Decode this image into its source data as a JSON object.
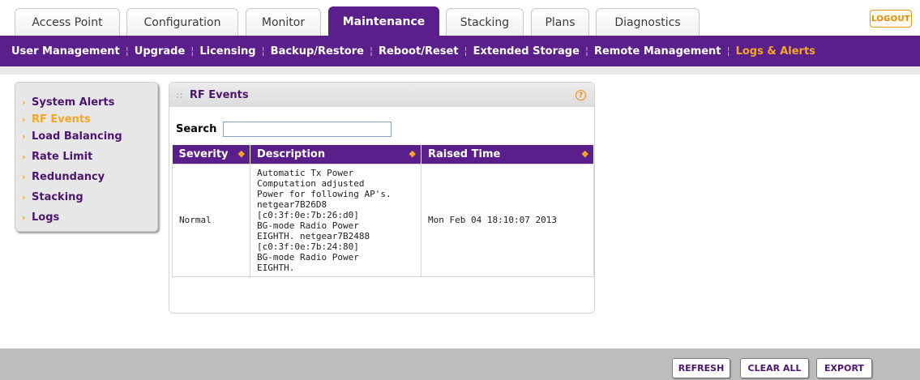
{
  "tabs": [
    {
      "label": "Access Point",
      "active": false
    },
    {
      "label": "Configuration",
      "active": false
    },
    {
      "label": "Monitor",
      "active": false
    },
    {
      "label": "Maintenance",
      "active": true
    },
    {
      "label": "Stacking",
      "active": false
    },
    {
      "label": "Plans",
      "active": false
    },
    {
      "label": "Diagnostics",
      "active": false
    }
  ],
  "logout_label": "LOGOUT",
  "subnav": [
    {
      "label": "User Management",
      "active": false
    },
    {
      "label": "Upgrade",
      "active": false
    },
    {
      "label": "Licensing",
      "active": false
    },
    {
      "label": "Backup/Restore",
      "active": false
    },
    {
      "label": "Reboot/Reset",
      "active": false
    },
    {
      "label": "Extended Storage",
      "active": false
    },
    {
      "label": "Remote Management",
      "active": false
    },
    {
      "label": "Logs & Alerts",
      "active": true
    }
  ],
  "leftmenu": [
    {
      "label": "System Alerts",
      "active": false
    },
    {
      "label": "RF Events",
      "active": true
    },
    {
      "label": "Load Balancing",
      "active": false
    },
    {
      "label": "Rate Limit",
      "active": false
    },
    {
      "label": "Redundancy",
      "active": false
    },
    {
      "label": "Stacking",
      "active": false
    },
    {
      "label": "Logs",
      "active": false
    }
  ],
  "panel": {
    "title": "RF Events",
    "help_icon": "?",
    "search_label": "Search",
    "search_value": "",
    "columns": [
      "Severity",
      "Description",
      "Raised Time"
    ],
    "rows": [
      {
        "severity": "Normal",
        "description": "Automatic Tx Power\nComputation adjusted\nPower for following AP's.\nnetgear7B26D8\n[c0:3f:0e:7b:26:d0]\nBG-mode Radio Power\nEIGHTH. netgear7B2488\n[c0:3f:0e:7b:24:80]\nBG-mode Radio Power\nEIGHTH.",
        "raised_time": "Mon Feb 04 18:10:07 2013"
      }
    ]
  },
  "footer": {
    "refresh_label": "REFRESH",
    "clear_all_label": "CLEAR ALL",
    "export_label": "EXPORT"
  },
  "colors": {
    "primary_purple": "#5b1f8c",
    "accent_orange": "#f5a623"
  }
}
